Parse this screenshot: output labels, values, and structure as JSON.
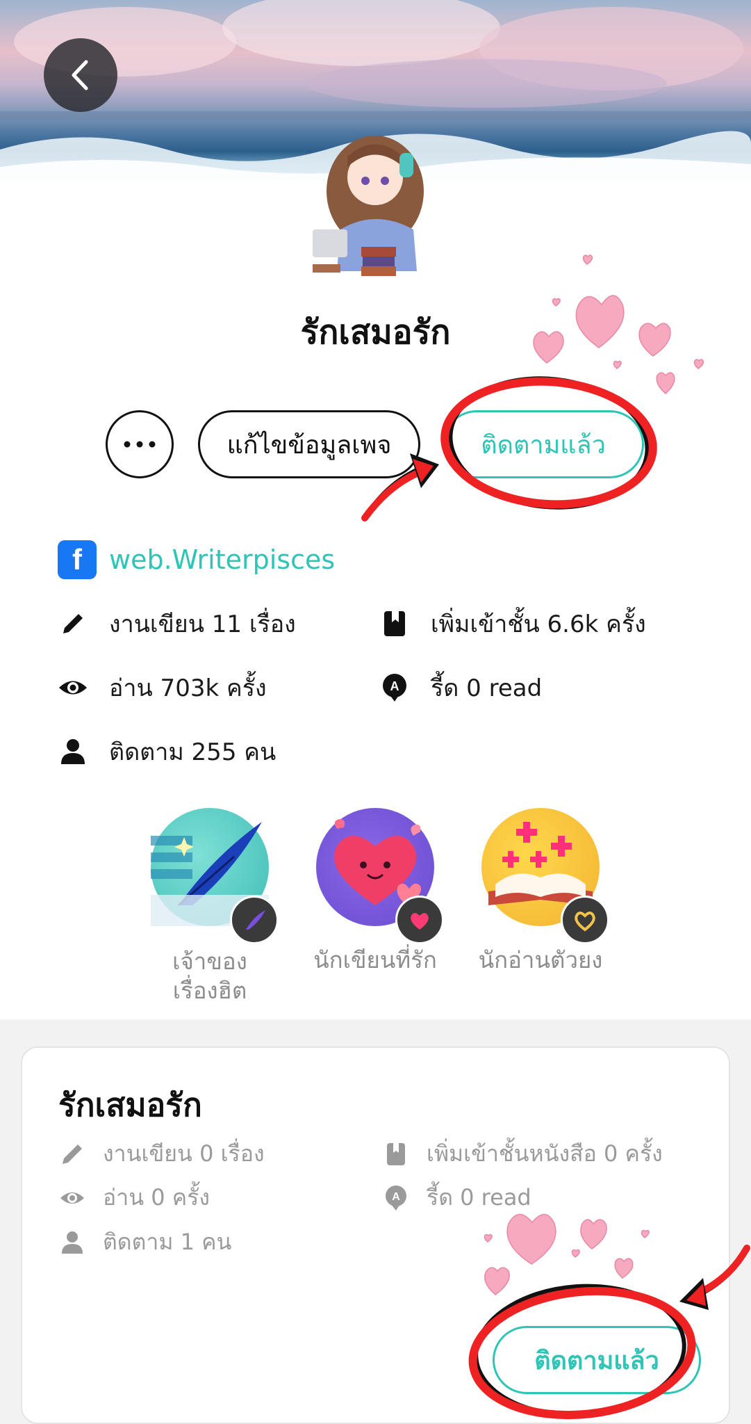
{
  "header": {
    "back_icon": "chevron-left-icon"
  },
  "profile": {
    "name": "รักเสมอรัก",
    "more_label": "···",
    "edit_label": "แก้ไขข้อมูลเพจ",
    "follow_label": "ติดตามแล้ว",
    "facebook_icon_text": "f",
    "facebook_link": "web.Writerpisces",
    "stats": {
      "works": "งานเขียน 11 เรื่อง",
      "shelf": "เพิ่มเข้าชั้น 6.6k ครั้ง",
      "reads": "อ่าน 703k ครั้ง",
      "reed": "รี้ด 0 read",
      "followers": "ติดตาม 255 คน"
    },
    "badges": [
      {
        "label": "เจ้าของ เรื่องฮิต",
        "icon": "quill-icon"
      },
      {
        "label": "นักเขียนที่รัก",
        "icon": "heart-icon"
      },
      {
        "label": "นักอ่านตัวยง",
        "icon": "open-book-icon"
      }
    ]
  },
  "card": {
    "name": "รักเสมอรัก",
    "stats": {
      "works": "งานเขียน 0 เรื่อง",
      "shelf": "เพิ่มเข้าชั้นหนังสือ 0 ครั้ง",
      "reads": "อ่าน 0 ครั้ง",
      "reed": "รี้ด 0 read",
      "followers": "ติดตาม 1 คน"
    },
    "follow_label": "ติดตามแล้ว"
  },
  "colors": {
    "accent": "#2ec4b6",
    "facebook": "#1877f2",
    "annotation_red": "#ee2222",
    "heart_pink": "#f7a9c0"
  }
}
